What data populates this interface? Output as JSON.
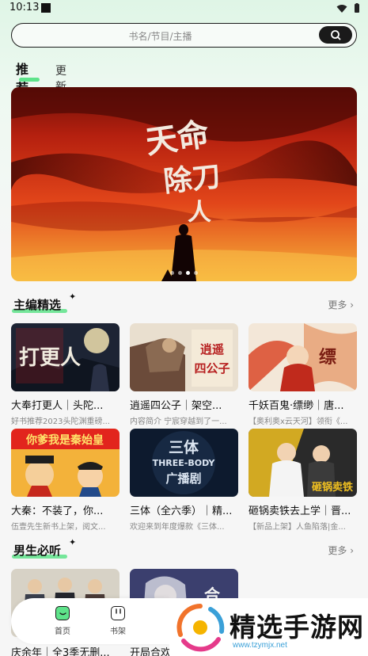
{
  "status_bar": {
    "time": "10:13"
  },
  "search": {
    "placeholder": "书名/节目/主播"
  },
  "tabs": [
    {
      "label": "推荐",
      "active": true
    },
    {
      "label": "更新",
      "active": false
    }
  ],
  "banner": {
    "title": "天命除刀人",
    "slide_count": 4,
    "active_slide": 2
  },
  "section_editor": {
    "title": "主编精选",
    "more": "更多 ›",
    "items": [
      {
        "title": "大奉打更人｜头陀...",
        "desc": "好书推荐2023头陀渊重磅...",
        "cover_text": "打更人"
      },
      {
        "title": "逍遥四公子｜架空...",
        "desc": "内容简介 宁宸穿越到了一...",
        "cover_text": "逍遥四公子"
      },
      {
        "title": "千妖百鬼·缥缈｜唐...",
        "desc": "【奥利奥x云天河】领衔《...",
        "cover_text": "缥缈"
      },
      {
        "title": "大秦：不装了，你...",
        "desc": "伍壹先生新书上架，阅文...",
        "cover_text": "你爹我是秦始皇"
      },
      {
        "title": "三体（全六季）｜精...",
        "desc": "欢迎来到年度爆款《三体...",
        "cover_text": "三体",
        "cover_sub": "THREE-BODY",
        "cover_sub2": "广播剧"
      },
      {
        "title": "砸锅卖铁去上学｜晋...",
        "desc": "【新品上架】人鱼陷落|金...",
        "cover_text": "砸锅卖铁"
      }
    ]
  },
  "section_male": {
    "title": "男生必听",
    "more": "更多 ›",
    "peek_titles": [
      "庆余年｜全3季无删...",
      "开局合欢"
    ]
  },
  "bottom_nav": [
    {
      "label": "首页",
      "icon": "home-icon",
      "active": true
    },
    {
      "label": "书架",
      "icon": "bookshelf-icon",
      "active": false
    }
  ],
  "watermark": {
    "text": "精选手游网",
    "url": "www.tzymjx.net"
  },
  "colors": {
    "accent": "#5ee38a",
    "dark": "#1a1a1a"
  }
}
